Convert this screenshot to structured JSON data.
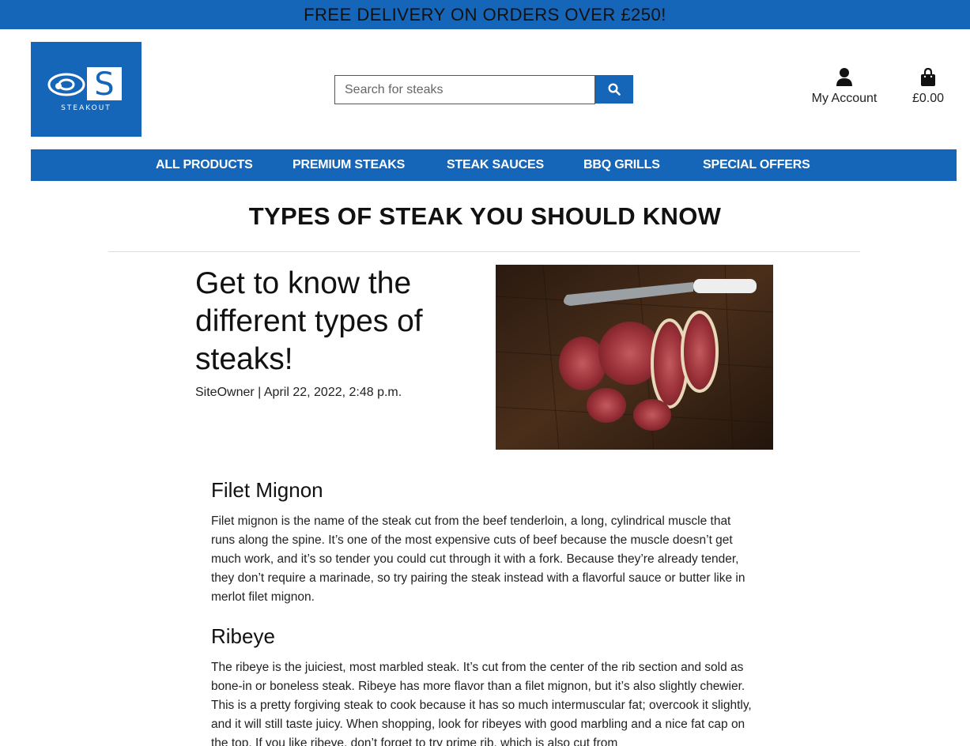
{
  "banner": {
    "text": "FREE DELIVERY ON ORDERS OVER £250!"
  },
  "logo": {
    "wordmark": "STEAKOUT",
    "letter": "S"
  },
  "search": {
    "placeholder": "Search for steaks"
  },
  "header": {
    "account_label": "My Account",
    "bag_total": "£0.00"
  },
  "nav": {
    "items": [
      {
        "label": "ALL PRODUCTS"
      },
      {
        "label": "PREMIUM STEAKS"
      },
      {
        "label": "STEAK SAUCES"
      },
      {
        "label": "BBQ GRILLS"
      },
      {
        "label": "SPECIAL OFFERS"
      }
    ]
  },
  "page": {
    "title": "TYPES OF STEAK YOU SHOULD KNOW"
  },
  "post": {
    "heading": "Get to know the different types of steaks!",
    "author": "SiteOwner",
    "separator": "|",
    "date": "April 22, 2022, 2:48 p.m.",
    "sections": [
      {
        "title": "Filet Mignon",
        "body": "Filet mignon is the name of the steak cut from the beef tenderloin, a long, cylindrical muscle that runs along the spine. It’s one of the most expensive cuts of beef because the muscle doesn’t get much work, and it’s so tender you could cut through it with a fork. Because they’re already tender, they don’t require a marinade, so try pairing the steak instead with a flavorful sauce or butter like in merlot filet mignon."
      },
      {
        "title": "Ribeye",
        "body": "The ribeye is the juiciest, most marbled steak. It’s cut from the center of the rib section and sold as bone-in or boneless steak. Ribeye has more flavor than a filet mignon, but it’s also slightly chewier. This is a pretty forgiving steak to cook because it has so much intermuscular fat; overcook it slightly, and it will still taste juicy. When shopping, look for ribeyes with good marbling and a nice fat cap on the top. If you like ribeye, don’t forget to try prime rib, which is also cut from"
      }
    ]
  },
  "colors": {
    "brand_blue": "#1565b8",
    "nav_text": "#ffffff"
  },
  "icons": [
    "search-icon",
    "user-icon",
    "shopping-bag-icon"
  ]
}
